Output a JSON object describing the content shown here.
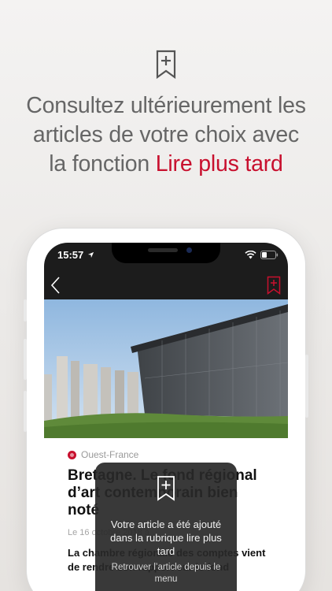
{
  "promo": {
    "headline_line1": "Consultez ultérieurement les",
    "headline_line2": "articles de votre choix avec",
    "headline_line3_prefix": "la fonction ",
    "headline_accent": "Lire plus tard",
    "accent_color": "#c8102e",
    "icon": "bookmark-plus-icon"
  },
  "status_bar": {
    "time": "15:57"
  },
  "nav": {
    "back_icon": "chevron-left-icon",
    "save_icon": "bookmark-plus-icon"
  },
  "article": {
    "source": "Ouest-France",
    "title": "Bretagne. Le fond régional d’art contemporain bien noté",
    "date": "Le 16 octobre 2018 à",
    "lead": "La chambre régionale des comptes vient de rendre son rapport sur le fond"
  },
  "toast": {
    "icon": "bookmark-plus-icon",
    "message": "Votre article a été ajouté dans la rubrique lire plus tard",
    "hint": "Retrouver l’article depuis le menu"
  }
}
